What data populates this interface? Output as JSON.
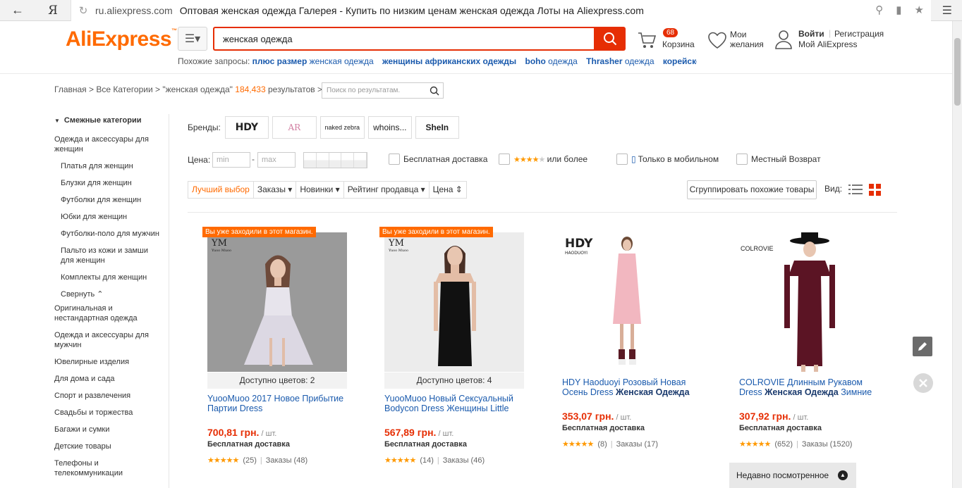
{
  "browser": {
    "host": "ru.aliexpress.com",
    "title": "Оптовая женская одежда Галерея - Купить по низким ценам женская одежда Лоты на Aliexpress.com"
  },
  "header": {
    "logo": "AliExpress",
    "search_value": "женская одежда",
    "cart_count": "68",
    "cart_label": "Корзина",
    "wish_line1": "Мои",
    "wish_line2": "желания",
    "login": "Войти",
    "register": "Регистрация",
    "my": "Мой AliExpress"
  },
  "related": {
    "label": "Похожие запросы:",
    "items": [
      {
        "bold": "плюс размер",
        "rest": " женская одежда"
      },
      {
        "bold": "женщины африканских одежды",
        "rest": ""
      },
      {
        "bold": "boho",
        "rest": " одежда"
      },
      {
        "bold": "Thrasher",
        "rest": " одежда"
      },
      {
        "bold": "корейской мо",
        "rest": ""
      }
    ]
  },
  "breadcrumb": {
    "home": "Главная",
    "all": "Все Категории",
    "query": "\"женская одежда\"",
    "count": "184,433",
    "results": "результатов",
    "search_placeholder": "Поиск по результатам."
  },
  "sidebar": {
    "title": "Смежные категории",
    "items": [
      {
        "label": "Одежда и аксессуары для женщин",
        "sub": false
      },
      {
        "label": "Платья для женщин",
        "sub": true
      },
      {
        "label": "Блузки для женщин",
        "sub": true
      },
      {
        "label": "Футболки для женщин",
        "sub": true
      },
      {
        "label": "Юбки для женщин",
        "sub": true
      },
      {
        "label": "Футболки-поло для мужчин",
        "sub": true
      },
      {
        "label": "Пальто из кожи и замши для женщин",
        "sub": true
      },
      {
        "label": "Комплекты для женщин",
        "sub": true
      },
      {
        "label": "Свернуть ⌃",
        "sub": true
      },
      {
        "label": "Оригинальная и нестандартная одежда",
        "sub": false
      },
      {
        "label": "Одежда и аксессуары для мужчин",
        "sub": false
      },
      {
        "label": "Ювелирные изделия",
        "sub": false
      },
      {
        "label": "Для дома и сада",
        "sub": false
      },
      {
        "label": "Спорт и развлечения",
        "sub": false
      },
      {
        "label": "Свадьбы и торжества",
        "sub": false
      },
      {
        "label": "Багажи и сумки",
        "sub": false
      },
      {
        "label": "Детские товары",
        "sub": false
      },
      {
        "label": "Телефоны и телекоммуникации",
        "sub": false
      }
    ]
  },
  "brands": {
    "label": "Бренды:",
    "items": [
      "HDY",
      "AR",
      "naked zebra",
      "whoins...",
      "SheIn"
    ]
  },
  "filters": {
    "price_label": "Цена:",
    "min_placeholder": "min",
    "max_placeholder": "max",
    "dash": "-",
    "free_shipping": "Бесплатная доставка",
    "or_more": "или более",
    "mobile_only": "Только в мобильном",
    "local_return": "Местный Возврат"
  },
  "sort": {
    "items": [
      "Лучший выбор",
      "Заказы ▾",
      "Новинки ▾",
      "Рейтинг продавца ▾",
      "Цена ⇕"
    ],
    "group": "Сгруппировать похожие товары",
    "view": "Вид:"
  },
  "products": [
    {
      "badge": "Вы уже заходили в этот магазин.",
      "colors": "Доступно цветов: 2",
      "title_pre": "YuooMuoo 2017 Новое Прибытие Партии Dress",
      "title_bold": "",
      "title_post": "",
      "price": "700,81 грн.",
      "unit": " / шт.",
      "shipping": "Бесплатная доставка",
      "reviews": "(25)",
      "orders": "Заказы (48)"
    },
    {
      "badge": "Вы уже заходили в этот магазин.",
      "colors": "Доступно цветов: 4",
      "title_pre": "YuooMuoo Новый Сексуальный Bodycon Dress Женщины Little",
      "title_bold": "",
      "title_post": "",
      "price": "567,89 грн.",
      "unit": " / шт.",
      "shipping": "Бесплатная доставка",
      "reviews": "(14)",
      "orders": "Заказы (46)"
    },
    {
      "badge": "",
      "colors": "",
      "title_pre": "HDY Haoduoyi Розовый Новая Осень Dress ",
      "title_bold": "Женская Одежда",
      "title_post": "",
      "price": "353,07 грн.",
      "unit": " / шт.",
      "shipping": "Бесплатная доставка",
      "reviews": "(8)",
      "orders": "Заказы (17)"
    },
    {
      "badge": "",
      "colors": "",
      "title_pre": "COLROVIE Длинным Рукавом Dress ",
      "title_bold": "Женская Одежда",
      "title_post": " Зимние",
      "price": "307,92 грн.",
      "unit": " / шт.",
      "shipping": "Бесплатная доставка",
      "reviews": "(652)",
      "orders": "Заказы (1520)"
    }
  ],
  "image_labels": {
    "ym": "YM",
    "ym_sub": "Yuoo Muoo",
    "hdy": "HDY",
    "hdy_sub": "HAODUOYI",
    "colrovie": "COLROVIE"
  },
  "recent": "Недавно посмотренное",
  "colors": {
    "accent": "#ff6a00",
    "search": "#e62e04",
    "link": "#1a5aad"
  }
}
